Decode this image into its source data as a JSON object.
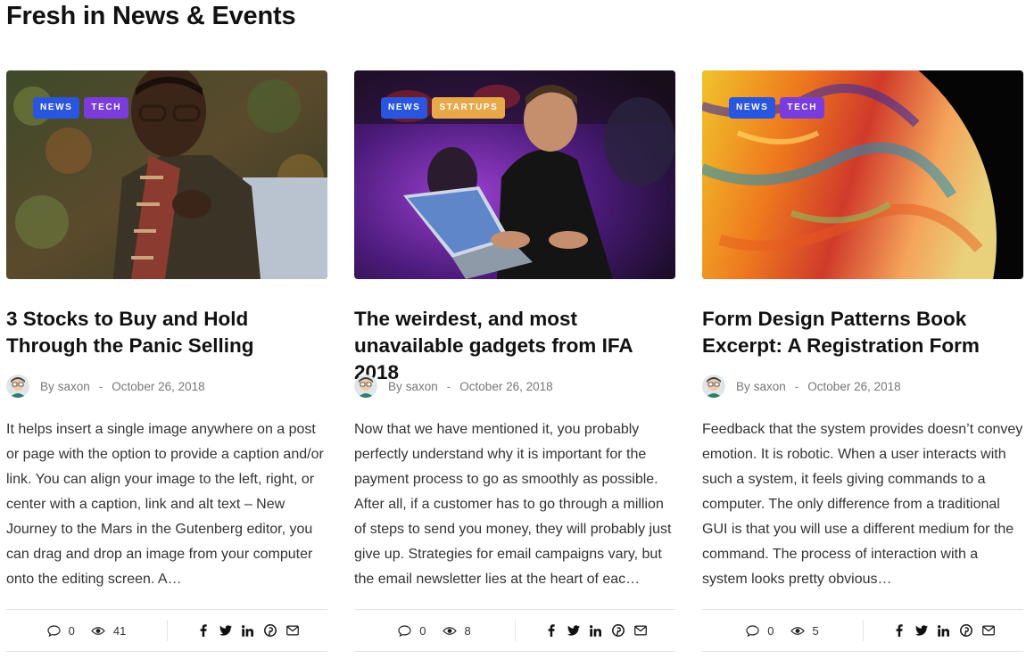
{
  "section": {
    "title": "Fresh in News & Events"
  },
  "byline_prefix": "By",
  "colors": {
    "news_tag": "#2a55de",
    "tech_tag": "#7a3ddc",
    "startups_tag": "#e7a84a",
    "text": "#111111",
    "muted": "#777777"
  },
  "icons": {
    "comment": "comment-icon",
    "views": "eye-icon",
    "facebook": "facebook-icon",
    "twitter": "twitter-icon",
    "linkedin": "linkedin-icon",
    "pinterest": "pinterest-icon",
    "email": "email-icon"
  },
  "cards": [
    {
      "tags": [
        "NEWS",
        "TECH"
      ],
      "title": "3 Stocks to Buy and Hold Through the Panic Selling",
      "author": "saxon",
      "date": "October 26, 2018",
      "excerpt": "It helps insert a single image anywhere on a post or page with the option to provide a caption and/or link. You can align your image to the left, right, or center with a caption, link and alt text – New Journey to the Mars in the Gutenberg editor, you can drag and drop an image from your computer onto the editing screen. A…",
      "comments": "0",
      "views": "41"
    },
    {
      "tags": [
        "NEWS",
        "STARTUPS"
      ],
      "title": "The weirdest, and most unavailable gadgets from IFA 2018",
      "author": "saxon",
      "date": "October 26, 2018",
      "excerpt": "Now that we have mentioned it, you probably perfectly understand why it is important for the payment process to go as smoothly as possible. After all, if a customer has to go through a million of steps to send you money, they will probably just give up. Strategies for email campaigns vary, but the email newsletter lies at the heart of eac…",
      "comments": "0",
      "views": "8"
    },
    {
      "tags": [
        "NEWS",
        "TECH"
      ],
      "title": "Form Design Patterns Book Excerpt: A Registration Form",
      "author": "saxon",
      "date": "October 26, 2018",
      "excerpt": "Feedback that the system provides doesn’t convey emotion. It is robotic. When a user interacts with such a system, it feels giving commands to a computer. The only difference from a traditional GUI is that you will use a different medium for the command. The process of interaction with a system looks pretty obvious…",
      "comments": "0",
      "views": "5"
    }
  ]
}
